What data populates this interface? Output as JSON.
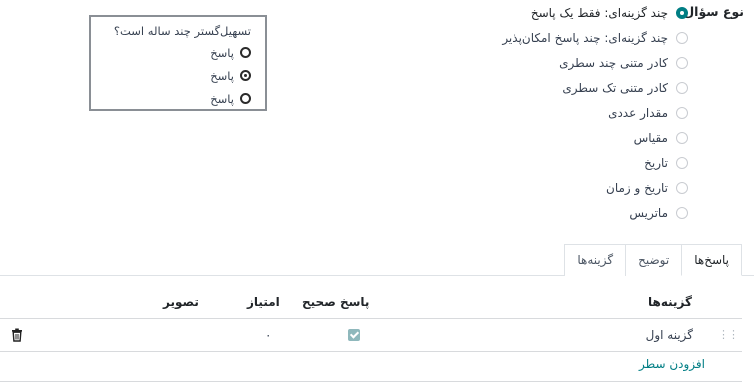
{
  "question_type": {
    "label": "نوع سؤال",
    "options": [
      {
        "label": "چند گزینه‌ای: فقط یک پاسخ",
        "selected": true
      },
      {
        "label": "چند گزینه‌ای: چند پاسخ امکان‌پذیر",
        "selected": false
      },
      {
        "label": "کادر متنی چند سطری",
        "selected": false
      },
      {
        "label": "کادر متنی تک سطری",
        "selected": false
      },
      {
        "label": "مقدار عددی",
        "selected": false
      },
      {
        "label": "مقیاس",
        "selected": false
      },
      {
        "label": "تاریخ",
        "selected": false
      },
      {
        "label": "تاریخ و زمان",
        "selected": false
      },
      {
        "label": "ماتریس",
        "selected": false
      }
    ]
  },
  "preview": {
    "question": "تسهیل‌گستر چند ساله است؟",
    "options": [
      {
        "label": "پاسخ",
        "checked": false
      },
      {
        "label": "پاسخ",
        "checked": true
      },
      {
        "label": "پاسخ",
        "checked": false
      }
    ]
  },
  "tabs": [
    {
      "label": "پاسخ‌ها",
      "active": true
    },
    {
      "label": "توضیح",
      "active": false
    },
    {
      "label": "گزینه‌ها",
      "active": false
    }
  ],
  "table": {
    "headers": {
      "choices": "گزینه‌ها",
      "correct": "پاسخ صحیح",
      "score": "امتیاز",
      "image": "تصویر"
    },
    "rows": [
      {
        "choice": "گزینه اول",
        "correct": true,
        "score": "۰"
      }
    ],
    "add_line": "افزودن سطر"
  },
  "colors": {
    "accent": "#017e84",
    "checkbox": "#8fb8bc"
  }
}
